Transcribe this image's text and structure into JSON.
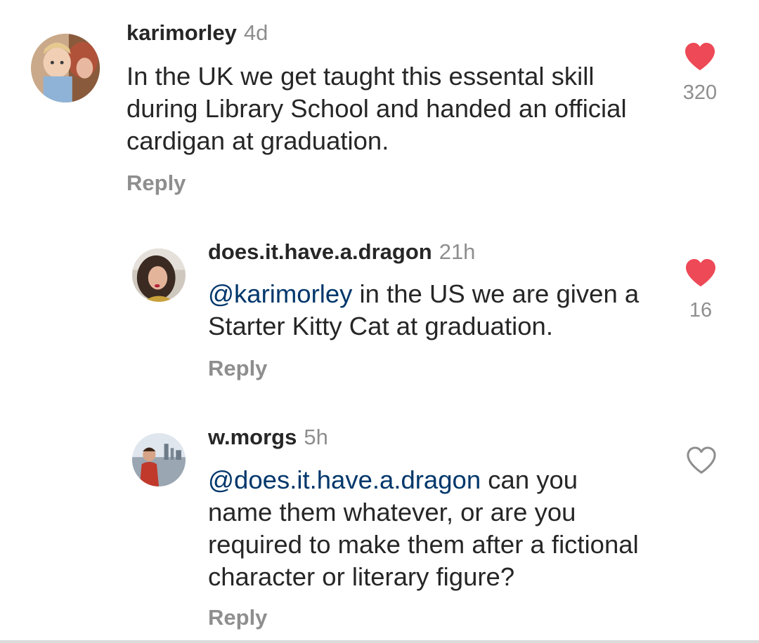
{
  "comments": [
    {
      "username": "karimorley",
      "time": "4d",
      "mention": "",
      "text": "In the UK we get taught this essental skill during Library School and handed an official cardigan at graduation.",
      "reply_label": "Reply",
      "liked": true,
      "like_count": "320",
      "avatar_icon": "avatar-photo-icon"
    },
    {
      "username": "does.it.have.a.dragon",
      "time": "21h",
      "mention": "@karimorley",
      "text": " in the US we are given a Starter Kitty Cat at graduation.",
      "reply_label": "Reply",
      "liked": true,
      "like_count": "16",
      "avatar_icon": "avatar-photo-icon"
    },
    {
      "username": "w.morgs",
      "time": "5h",
      "mention": "@does.it.have.a.dragon",
      "text": " can you name them whatever, or are you required to make them after a fictional character or literary figure?",
      "reply_label": "Reply",
      "liked": false,
      "like_count": "",
      "avatar_icon": "avatar-photo-icon"
    }
  ],
  "colors": {
    "like_red": "#ed4956",
    "mention_blue": "#00376b",
    "muted_gray": "#8e8e8e",
    "text": "#262626"
  },
  "icons": {
    "heart_filled": "heart-filled-icon",
    "heart_outline": "heart-outline-icon"
  }
}
